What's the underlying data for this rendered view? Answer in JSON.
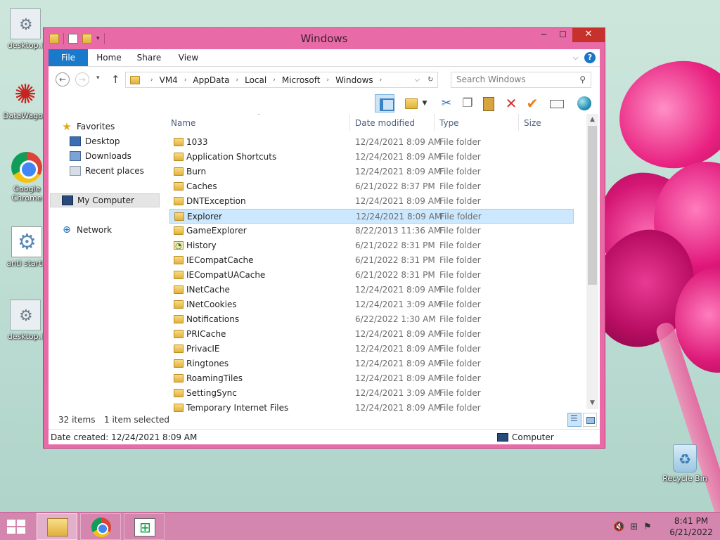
{
  "desktop": {
    "icons": [
      {
        "label": "desktop.i"
      },
      {
        "label": "DataWagon"
      },
      {
        "label": "Google Chrome"
      },
      {
        "label": "anti startb"
      },
      {
        "label": "desktop.i"
      },
      {
        "label": "Recycle Bin"
      }
    ]
  },
  "window": {
    "title": "Windows",
    "controls": {
      "minimize": "─",
      "maximize": "☐",
      "close": "✕"
    },
    "ribbon": {
      "tabs": [
        {
          "label": "File",
          "active": true
        },
        {
          "label": "Home"
        },
        {
          "label": "Share"
        },
        {
          "label": "View"
        }
      ],
      "expand_icon": "⌵",
      "help_icon": "?"
    },
    "navigation": {
      "back": "←",
      "forward": "→",
      "recent": "▾",
      "up": "↑",
      "breadcrumb": [
        "VM4",
        "AppData",
        "Local",
        "Microsoft",
        "Windows"
      ],
      "breadcrumb_sep": "›",
      "refresh": "↻",
      "dropdown": "⌵",
      "search_placeholder": "Search Windows",
      "search_icon": "⚲"
    },
    "nav_pane": {
      "favorites_label": "Favorites",
      "favorites": [
        {
          "label": "Desktop",
          "icon": "desktop-icon"
        },
        {
          "label": "Downloads",
          "icon": "downloads-icon"
        },
        {
          "label": "Recent places",
          "icon": "recent-places-icon"
        }
      ],
      "computer_label": "My Computer",
      "network_label": "Network"
    },
    "columns": {
      "name": "Name",
      "date": "Date modified",
      "type": "Type",
      "size": "Size"
    },
    "files": [
      {
        "name": "1033",
        "date": "12/24/2021 8:09 AM",
        "type": "File folder"
      },
      {
        "name": "Application Shortcuts",
        "date": "12/24/2021 8:09 AM",
        "type": "File folder"
      },
      {
        "name": "Burn",
        "date": "12/24/2021 8:09 AM",
        "type": "File folder"
      },
      {
        "name": "Caches",
        "date": "6/21/2022 8:37 PM",
        "type": "File folder"
      },
      {
        "name": "DNTException",
        "date": "12/24/2021 8:09 AM",
        "type": "File folder"
      },
      {
        "name": "Explorer",
        "date": "12/24/2021 8:09 AM",
        "type": "File folder",
        "selected": true
      },
      {
        "name": "GameExplorer",
        "date": "8/22/2013 11:36 AM",
        "type": "File folder"
      },
      {
        "name": "History",
        "date": "6/21/2022 8:31 PM",
        "type": "File folder",
        "icon": "history"
      },
      {
        "name": "IECompatCache",
        "date": "6/21/2022 8:31 PM",
        "type": "File folder"
      },
      {
        "name": "IECompatUACache",
        "date": "6/21/2022 8:31 PM",
        "type": "File folder"
      },
      {
        "name": "INetCache",
        "date": "12/24/2021 8:09 AM",
        "type": "File folder"
      },
      {
        "name": "INetCookies",
        "date": "12/24/2021 3:09 AM",
        "type": "File folder"
      },
      {
        "name": "Notifications",
        "date": "6/22/2022 1:30 AM",
        "type": "File folder"
      },
      {
        "name": "PRICache",
        "date": "12/24/2021 8:09 AM",
        "type": "File folder"
      },
      {
        "name": "PrivacIE",
        "date": "12/24/2021 8:09 AM",
        "type": "File folder"
      },
      {
        "name": "Ringtones",
        "date": "12/24/2021 8:09 AM",
        "type": "File folder"
      },
      {
        "name": "RoamingTiles",
        "date": "12/24/2021 8:09 AM",
        "type": "File folder"
      },
      {
        "name": "SettingSync",
        "date": "12/24/2021 3:09 AM",
        "type": "File folder"
      },
      {
        "name": "Temporary Internet Files",
        "date": "12/24/2021 8:09 AM",
        "type": "File folder"
      }
    ],
    "status": {
      "item_count": "32 items",
      "selection": "1 item selected"
    },
    "info": {
      "date_created": "Date created: 12/24/2021 8:09 AM",
      "location": "Computer"
    }
  },
  "taskbar": {
    "apps": [
      {
        "name": "File Explorer",
        "active": true
      },
      {
        "name": "Google Chrome"
      },
      {
        "name": "Store"
      }
    ],
    "tray_icons": [
      "volume-muted-icon",
      "network-icon",
      "action-center-icon"
    ],
    "clock": {
      "time": "8:41 PM",
      "date": "6/21/2022"
    }
  },
  "colors": {
    "window_frame": "#e86aa6",
    "selection": "#cce8ff",
    "file_tab": "#1979ca",
    "close_button": "#c7312c"
  }
}
